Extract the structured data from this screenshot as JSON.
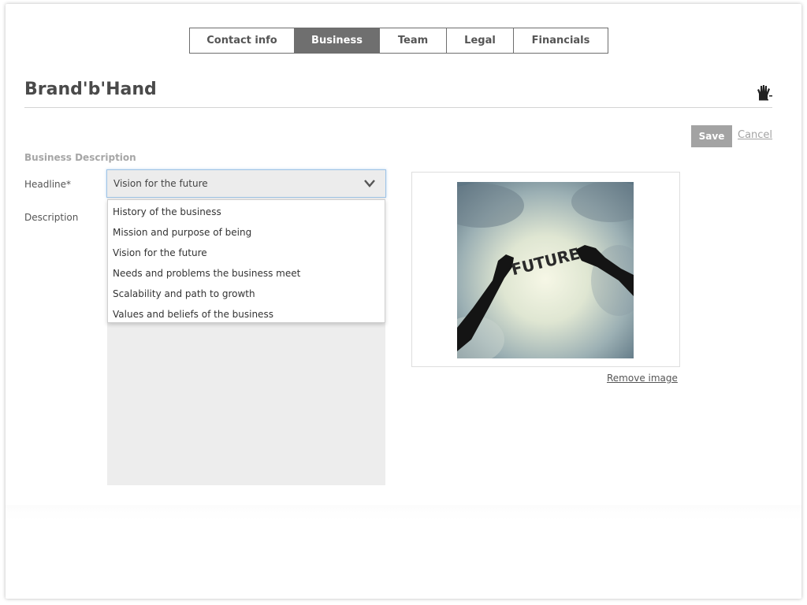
{
  "tabs": [
    {
      "label": "Contact info",
      "active": false
    },
    {
      "label": "Business",
      "active": true
    },
    {
      "label": "Team",
      "active": false
    },
    {
      "label": "Legal",
      "active": false
    },
    {
      "label": "Financials",
      "active": false
    }
  ],
  "header": {
    "brand_name": "Brand'b'Hand",
    "logo_icon": "hand-icon"
  },
  "actions": {
    "save_label": "Save",
    "cancel_label": "Cancel"
  },
  "form": {
    "section_label": "Business Description",
    "headline_label": "Headline*",
    "description_label": "Description",
    "headline_value": "Vision for the future",
    "headline_options": [
      "History of the business",
      "Mission and purpose of being",
      "Vision for the future",
      "Needs and problems the business meet",
      "Scalability and path to growth",
      "Values and beliefs of the business"
    ],
    "description_value": ""
  },
  "image": {
    "caption": "FUTURE",
    "remove_label": "Remove image"
  },
  "colors": {
    "tab_active": "#6f6f6f",
    "save_button": "#a3a3a3",
    "focus_border": "#9ec3e6",
    "field_bg": "#ececec"
  }
}
